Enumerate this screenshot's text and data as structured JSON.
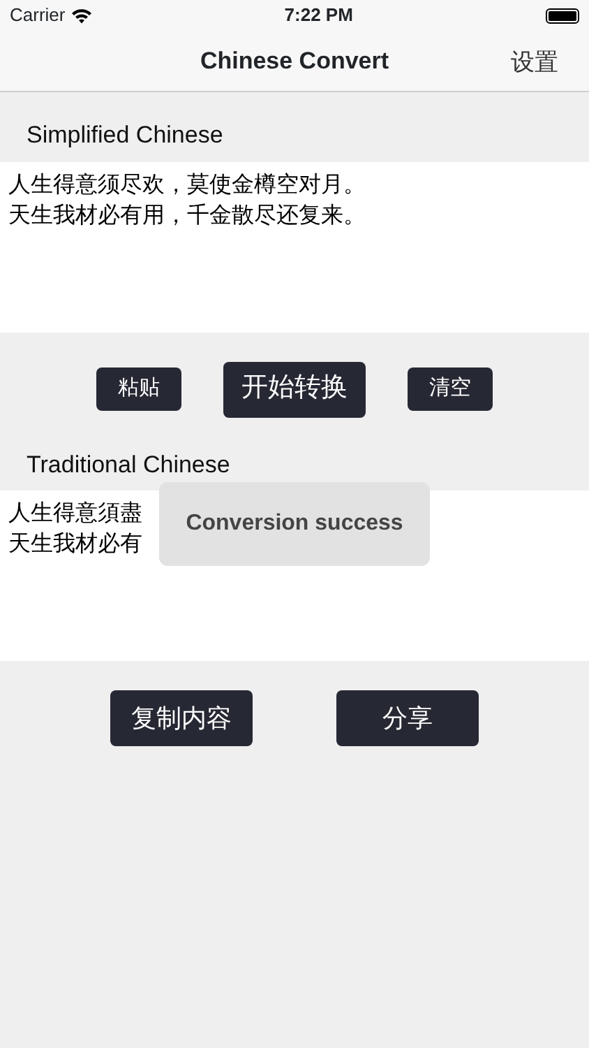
{
  "status_bar": {
    "carrier": "Carrier",
    "time": "7:22 PM"
  },
  "nav": {
    "title": "Chinese Convert",
    "right_button": "设置"
  },
  "source": {
    "label": "Simplified Chinese",
    "lines": [
      "人生得意须尽欢，莫使金樽空对月。",
      "天生我材必有用，千金散尽还复来。"
    ]
  },
  "convert_buttons": [
    {
      "label": "粘贴",
      "kind": "small"
    },
    {
      "label": "开始转换",
      "kind": "large"
    },
    {
      "label": "清空",
      "kind": "small"
    }
  ],
  "result": {
    "label": "Traditional Chinese",
    "lines": [
      "人生得意須盡",
      "天生我材必有"
    ]
  },
  "result_buttons": [
    "复制内容",
    "分享"
  ],
  "toast": {
    "text": "Conversion success"
  }
}
